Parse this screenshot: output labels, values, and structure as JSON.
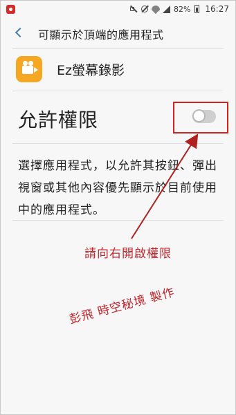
{
  "status_bar": {
    "battery_percent": "82%",
    "time": "16:27",
    "icons": [
      "screen-record-icon",
      "mute-icon",
      "alarm-off-icon",
      "wifi-icon",
      "signal-icon",
      "battery-icon"
    ]
  },
  "header": {
    "back_icon": "chevron-left-icon",
    "title": "可顯示於頂端的應用程式"
  },
  "app": {
    "icon": "video-camera-icon",
    "icon_color": "#f5a623",
    "name": "Ez螢幕錄影"
  },
  "permission": {
    "label": "允許權限",
    "toggle_state": "off"
  },
  "description": "選擇應用程式，以允許其按鈕、彈出視窗或其他內容優先顯示於目前使用中的應用程式。",
  "annotations": {
    "instruction": "請向右開啟權限",
    "credit": "彭飛 時空秘境 製作",
    "color": "#c4232a"
  }
}
